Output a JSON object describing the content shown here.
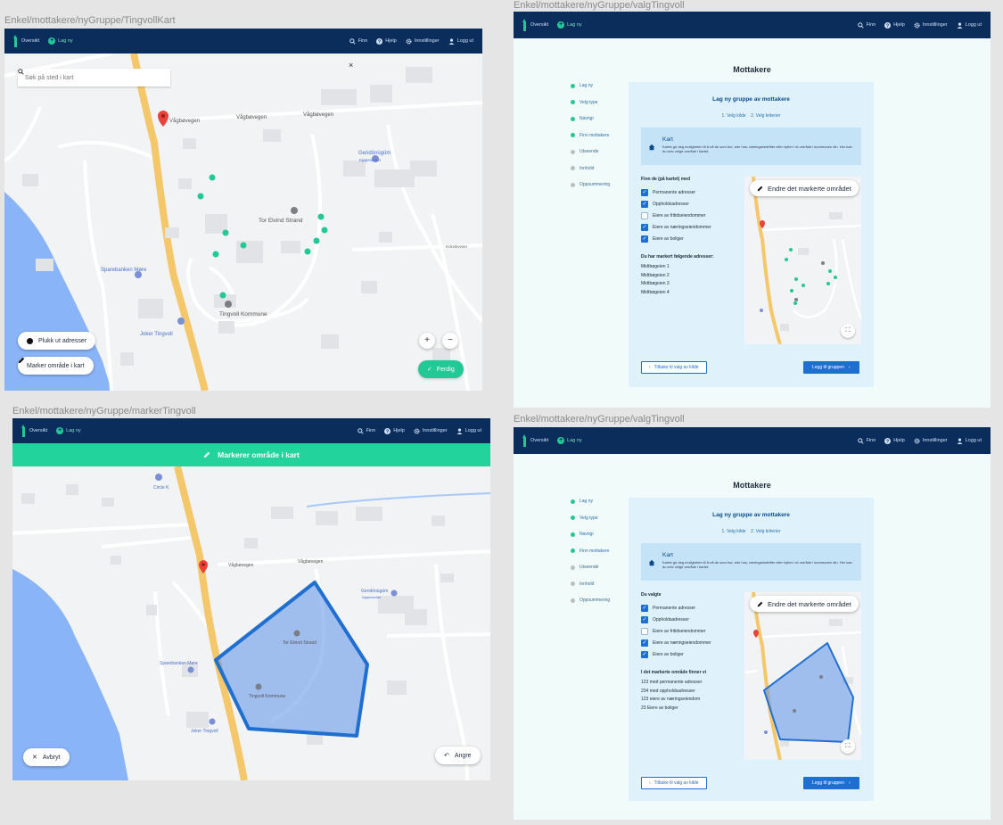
{
  "frames": {
    "f1": {
      "label": "Enkel/mottakere/nyGruppe/TingvollKart"
    },
    "f2": {
      "label": "Enkel/mottakere/nyGruppe/valgTingvoll"
    },
    "f3": {
      "label": "Enkel/mottakere/nyGruppe/markerTingvoll"
    },
    "f4": {
      "label": "Enkel/mottakere/nyGruppe/valgTingvoll"
    }
  },
  "nav": {
    "overview": "Oversikt",
    "new": "Lag ny",
    "find": "Finn",
    "help": "Hjelp",
    "settings": "Innstillinger",
    "logout": "Logg ut"
  },
  "map1": {
    "search_placeholder": "Søk på sted i kart",
    "close": "×",
    "pick_addresses": "Plukk ut adresser",
    "mark_area": "Marker område i kart",
    "zoom_in": "+",
    "zoom_out": "−",
    "done": "Ferdig",
    "labels": {
      "vagbovegen1": "Vågbøvegen",
      "vagbovegen2": "Vågbøvegen",
      "vagbovegen3": "Vågbøvegen",
      "poi_shop": "Geridönügüm",
      "poi_shop_sub": "Kjøpesenter",
      "poi_tor": "Tor Elvind Strand",
      "poi_bank": "Sparebanken Møre",
      "poi_kommune": "Tingvoll Kommune",
      "poi_joker": "Joker Tingvoll",
      "kokvikveien": "Kokvikveien"
    }
  },
  "map3": {
    "bar_title": "Markerer område i kart",
    "cancel": "Avbryt",
    "undo": "Angre",
    "labels": {
      "circle_k": "Circle K",
      "kokvikveien": "Kokvikvelva",
      "vagbovegen": "Vågbøvegen",
      "vagbovegen2": "Vågbøvegen",
      "poi_shop": "Geridönügüm",
      "poi_shop_sub": "Kjøpesenter",
      "poi_tor": "Tor Elvind Strand",
      "poi_bank": "Sparebanken Møre",
      "poi_kommune": "Tingvoll Kommune",
      "poi_joker": "Joker Tingvoll"
    }
  },
  "page": {
    "title": "Mottakere",
    "steps": [
      "Lag ny",
      "Velg type",
      "Navngi",
      "Finn mottakere",
      "Utseende",
      "Innhold",
      "Oppsummering"
    ],
    "panel_title": "Lag ny gruppe av mottakere",
    "tab1": "1. Velg kilde",
    "tab2": "2. Velg kriterier",
    "info_title": "Kart",
    "info_desc": "Kartet gir deg muligheten til å nå de som bor, eier hus, næringsbedrifter eller hytter i et område i kommunen din. Her kan du selv velge område i kartet.",
    "edit_area": "Endre det markerte området",
    "back": "Tilbake til valg av kilde",
    "next": "Legg til gruppen"
  },
  "f2": {
    "find_heading": "Finn de (på kartet) med",
    "options": [
      {
        "label": "Permanente adresser",
        "checked": true
      },
      {
        "label": "Oppholdsadresser",
        "checked": true
      },
      {
        "label": "Eiere av fritidseiendommer",
        "checked": false
      },
      {
        "label": "Eiere av næringseiendommer",
        "checked": true
      },
      {
        "label": "Eiere av boliger",
        "checked": true
      }
    ],
    "addr_heading": "Du har markert følgende adresser:",
    "addresses": [
      "Midtbøgeien 1",
      "Midtbøgeien 2",
      "Midtbøgeien 3",
      "Midtbøgeien 4"
    ]
  },
  "f4": {
    "find_heading": "Du valgte",
    "options": [
      {
        "label": "Permanente adresser",
        "checked": true
      },
      {
        "label": "Oppholdsadresser",
        "checked": true
      },
      {
        "label": "Eiere av fritidseiendommer",
        "checked": false
      },
      {
        "label": "Eiere av næringseiendommer",
        "checked": true
      },
      {
        "label": "Eiere av boliger",
        "checked": true
      }
    ],
    "result_heading": "I det markerte område finner vi",
    "results": [
      "123 med permanente adresser",
      "234 med oppholdsadresser",
      "123 eiere av næringseiendom",
      "23 Eiere av boliger"
    ]
  },
  "colors": {
    "nav": "#0b2d5c",
    "accent": "#22c997",
    "primary": "#1f6fd1",
    "road_main": "#f5c76b",
    "water": "#8ab4f8",
    "polygon": "#1f6fd1"
  }
}
